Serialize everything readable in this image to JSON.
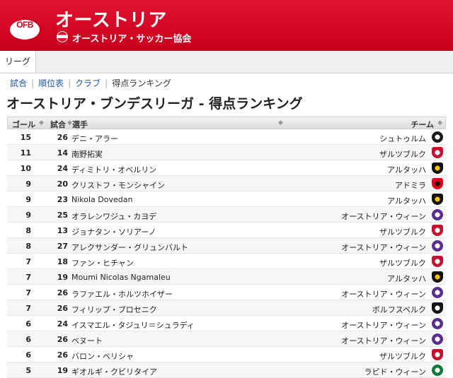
{
  "header": {
    "logo_text": "ÖFB",
    "title": "オーストリア",
    "subtitle": "オーストリア・サッカー協会"
  },
  "tabs": [
    {
      "label": "リーグ"
    }
  ],
  "breadcrumb": [
    "試合",
    "順位表",
    "クラブ",
    "得点ランキング"
  ],
  "page_title": "オーストリア・ブンデスリーガ - 得点ランキング",
  "table": {
    "columns": {
      "goals": "ゴール",
      "apps": "試合",
      "player": "選手",
      "team": "チーム"
    },
    "rows": [
      {
        "goals": "15",
        "apps": "26",
        "player": "デニ・アラー",
        "team": "シュトゥルム",
        "crest": "sturm-crest-icon",
        "c1": "#1a1a1a",
        "c2": "#ffffff"
      },
      {
        "goals": "11",
        "apps": "14",
        "player": "南野拓実",
        "team": "ザルツブルク",
        "crest": "salzburg-crest-icon",
        "c1": "#c8102e",
        "c2": "#ffffff"
      },
      {
        "goals": "10",
        "apps": "24",
        "player": "ディミトリ・オベルリン",
        "team": "アルタッハ",
        "crest": "altach-crest-icon",
        "c1": "#111111",
        "c2": "#f2c400"
      },
      {
        "goals": "9",
        "apps": "20",
        "player": "クリストフ・モンシャイン",
        "team": "アドミラ",
        "crest": "admira-crest-icon",
        "c1": "#e2001a",
        "c2": "#111111"
      },
      {
        "goals": "9",
        "apps": "23",
        "player": "Nikola Dovedan",
        "team": "アルタッハ",
        "crest": "altach-crest-icon",
        "c1": "#111111",
        "c2": "#f2c400"
      },
      {
        "goals": "9",
        "apps": "25",
        "player": "オラレンワジュ・カヨデ",
        "team": "オーストリア・ウィーン",
        "crest": "austria-wien-crest-icon",
        "c1": "#5b2d8e",
        "c2": "#ffffff"
      },
      {
        "goals": "8",
        "apps": "13",
        "player": "ジョナタン・ソリアーノ",
        "team": "ザルツブルク",
        "crest": "salzburg-crest-icon",
        "c1": "#c8102e",
        "c2": "#ffffff"
      },
      {
        "goals": "8",
        "apps": "27",
        "player": "アレクサンダー・グリュンバルト",
        "team": "オーストリア・ウィーン",
        "crest": "austria-wien-crest-icon",
        "c1": "#5b2d8e",
        "c2": "#ffffff"
      },
      {
        "goals": "7",
        "apps": "18",
        "player": "ファン・ヒチャン",
        "team": "ザルツブルク",
        "crest": "salzburg-crest-icon",
        "c1": "#c8102e",
        "c2": "#ffffff"
      },
      {
        "goals": "7",
        "apps": "19",
        "player": "Moumi Nicolas Ngamaleu",
        "team": "アルタッハ",
        "crest": "altach-crest-icon",
        "c1": "#111111",
        "c2": "#f2c400"
      },
      {
        "goals": "7",
        "apps": "26",
        "player": "ラファエル・ホルツホイザー",
        "team": "オーストリア・ウィーン",
        "crest": "austria-wien-crest-icon",
        "c1": "#5b2d8e",
        "c2": "#ffffff"
      },
      {
        "goals": "7",
        "apps": "26",
        "player": "フィリップ・プロセニク",
        "team": "ボルフスベルク",
        "crest": "wolfsberg-crest-icon",
        "c1": "#111111",
        "c2": "#ffffff"
      },
      {
        "goals": "6",
        "apps": "24",
        "player": "イスマエル・タジュリ＝シュラディ",
        "team": "オーストリア・ウィーン",
        "crest": "austria-wien-crest-icon",
        "c1": "#5b2d8e",
        "c2": "#ffffff"
      },
      {
        "goals": "6",
        "apps": "26",
        "player": "ベヌート",
        "team": "オーストリア・ウィーン",
        "crest": "austria-wien-crest-icon",
        "c1": "#5b2d8e",
        "c2": "#ffffff"
      },
      {
        "goals": "6",
        "apps": "26",
        "player": "バロン・ベリシャ",
        "team": "ザルツブルク",
        "crest": "salzburg-crest-icon",
        "c1": "#c8102e",
        "c2": "#ffffff"
      },
      {
        "goals": "5",
        "apps": "19",
        "player": "ギオルギ・クビリタイア",
        "team": "ラピド・ウィーン",
        "crest": "rapid-wien-crest-icon",
        "c1": "#0a7a3a",
        "c2": "#ffffff"
      }
    ]
  },
  "colors": {
    "header_red": "#c8001e",
    "link_blue": "#1a55a8"
  }
}
